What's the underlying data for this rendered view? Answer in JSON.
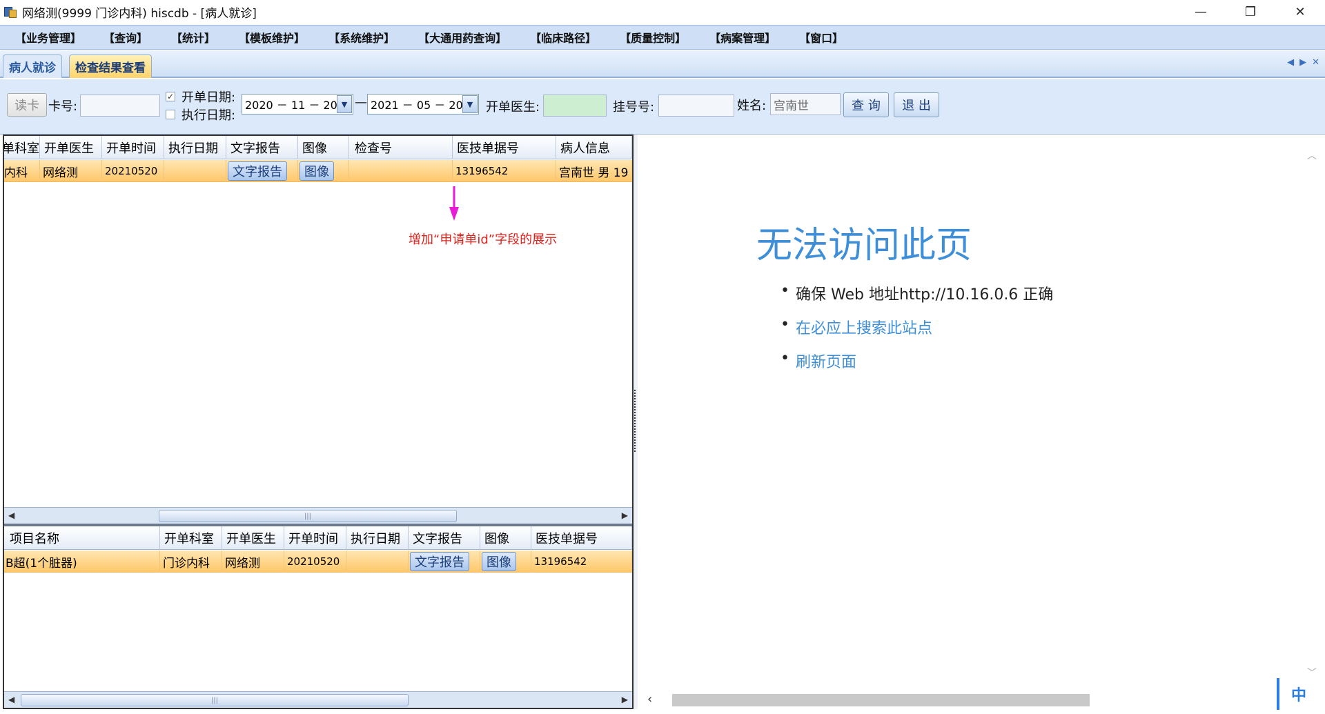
{
  "window": {
    "title": "网络测(9999 门诊内科)  hiscdb - [病人就诊]",
    "controls": [
      "—",
      "❐",
      "✕"
    ]
  },
  "menu": [
    "【业务管理】",
    "【查询】",
    "【统计】",
    "【模板维护】",
    "【系统维护】",
    "【大通用药查询】",
    "【临床路径】",
    "【质量控制】",
    "【病案管理】",
    "【窗口】"
  ],
  "tabs": [
    {
      "label": "病人就诊",
      "active": false
    },
    {
      "label": "检查结果查看",
      "active": true
    }
  ],
  "tab_nav": [
    "◀",
    "▶",
    "✕"
  ],
  "toolbar": {
    "read_card_label": "读卡",
    "card_no_label": "卡号:",
    "card_no_value": "",
    "open_date_label": "开单日期:",
    "open_date_checked": true,
    "exec_date_label": "执行日期:",
    "exec_date_checked": false,
    "date_from": "2020 － 11 － 20",
    "date_sep": "—",
    "date_to": "2021 － 05 － 20",
    "doctor_label": "开单医生:",
    "doctor_value": "",
    "reg_no_label": "挂号号:",
    "reg_no_value": "",
    "name_label": "姓名:",
    "name_value": "宫南世",
    "query_label": "查 询",
    "exit_label": "退 出"
  },
  "upper_grid": {
    "columns": [
      "单科室",
      "开单医生",
      "开单时间",
      "执行日期",
      "文字报告",
      "图像",
      "检查号",
      "医技单据号",
      "病人信息"
    ],
    "row": {
      "dept": "内科",
      "doctor": "网络测",
      "time": "20210520",
      "exec_date": "",
      "report": "文字报告",
      "image": "图像",
      "check_no": "",
      "doc_no": "13196542",
      "patient": "宫南世  男  19"
    }
  },
  "annotation": {
    "text": "增加“申请单id”字段的展示",
    "color": "#e0201a",
    "arrow_color": "#e81bd6"
  },
  "lower_grid": {
    "columns": [
      "项目名称",
      "开单科室",
      "开单医生",
      "开单时间",
      "执行日期",
      "文字报告",
      "图像",
      "医技单据号"
    ],
    "row": {
      "item": "B超(1个脏器)",
      "dept": "门诊内科",
      "doctor": "网络测",
      "time": "20210520",
      "exec_date": "",
      "report": "文字报告",
      "image": "图像",
      "doc_no": "13196542"
    }
  },
  "browser_error": {
    "title": "无法访问此页",
    "items": [
      {
        "text": "确保 Web 地址http://10.16.0.6 正确",
        "link": false
      },
      {
        "text": "在必应上搜索此站点",
        "link": true
      },
      {
        "text": "刷新页面",
        "link": true
      }
    ]
  },
  "ime_indicator": "中",
  "colors": {
    "menu_bg": "#cfe0f6",
    "row_highlight": "#ffc76a",
    "link_blue": "#3e8fd8"
  }
}
